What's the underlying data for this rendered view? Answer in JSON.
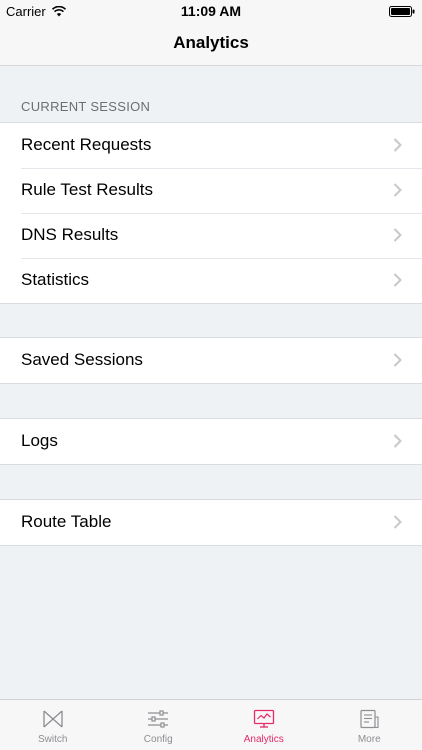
{
  "status_bar": {
    "carrier": "Carrier",
    "time": "11:09 AM"
  },
  "nav": {
    "title": "Analytics"
  },
  "current_session": {
    "header": "CURRENT SESSION",
    "items": [
      {
        "label": "Recent Requests"
      },
      {
        "label": "Rule Test Results"
      },
      {
        "label": "DNS Results"
      },
      {
        "label": "Statistics"
      }
    ]
  },
  "saved": {
    "items": [
      {
        "label": "Saved Sessions"
      }
    ]
  },
  "logs": {
    "items": [
      {
        "label": "Logs"
      }
    ]
  },
  "routes": {
    "items": [
      {
        "label": "Route Table"
      }
    ]
  },
  "tab_bar": {
    "active_color": "#e5296a",
    "inactive_color": "#8e8e93",
    "tabs": [
      {
        "label": "Switch",
        "icon": "switch-icon",
        "active": false
      },
      {
        "label": "Config",
        "icon": "sliders-icon",
        "active": false
      },
      {
        "label": "Analytics",
        "icon": "monitor-chart-icon",
        "active": true
      },
      {
        "label": "More",
        "icon": "document-icon",
        "active": false
      }
    ]
  }
}
